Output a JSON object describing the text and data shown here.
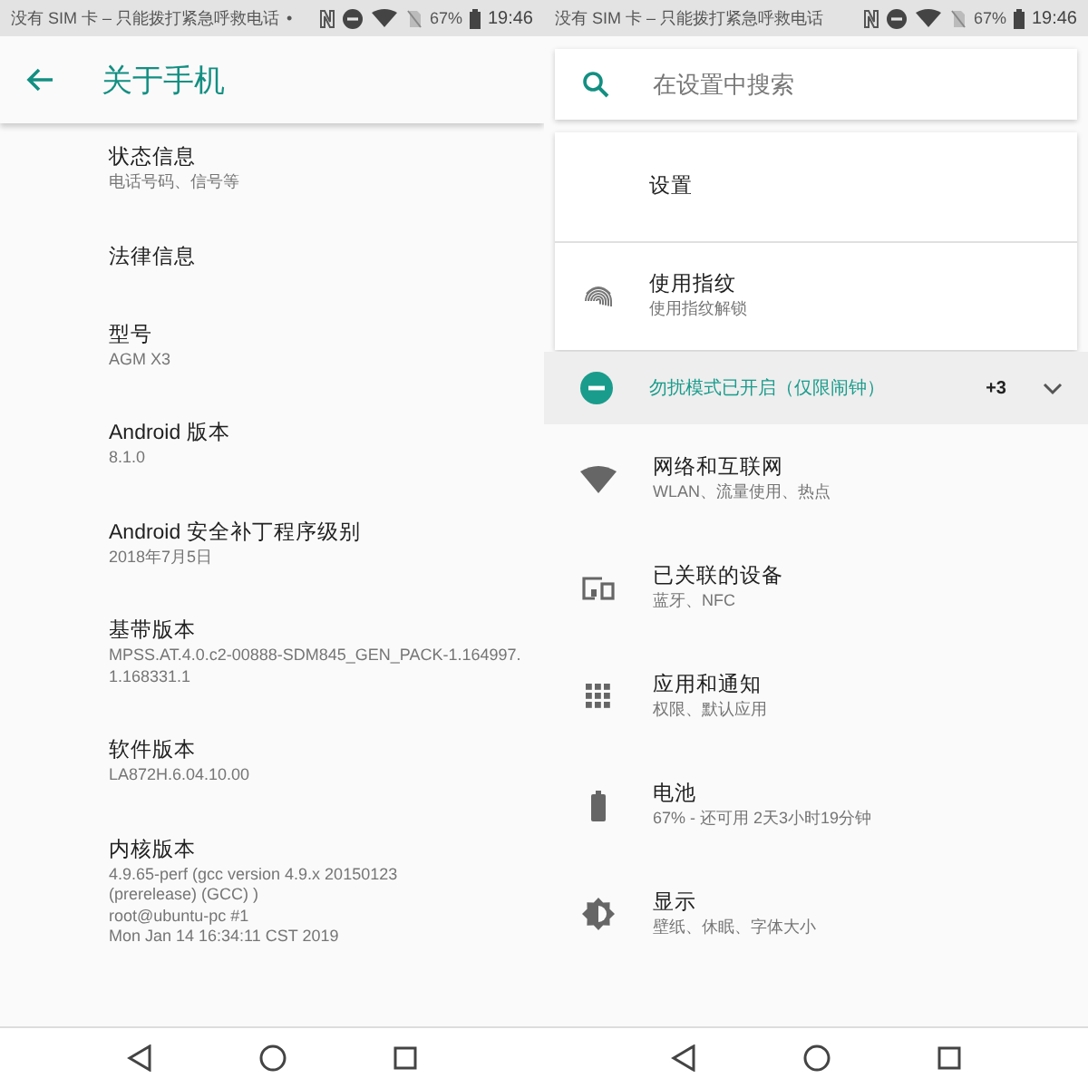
{
  "left": {
    "status_bar": {
      "notice": "没有 SIM 卡 – 只能拨打紧急呼救电话",
      "notice_dot": "•",
      "battery": "67%",
      "time": "19:46"
    },
    "app_bar": {
      "title": "关于手机"
    },
    "items": [
      {
        "title": "状态信息",
        "subtitle": "电话号码、信号等"
      },
      {
        "title": "法律信息"
      },
      {
        "title": "型号",
        "subtitle": "AGM X3"
      },
      {
        "title": "Android 版本",
        "subtitle": "8.1.0"
      },
      {
        "title": "Android 安全补丁程序级别",
        "subtitle": "2018年7月5日"
      },
      {
        "title": "基带版本",
        "subtitle": "MPSS.AT.4.0.c2-00888-SDM845_GEN_PACK-1.164997.1.168331.1"
      },
      {
        "title": "软件版本",
        "subtitle": "LA872H.6.04.10.00"
      },
      {
        "title": "内核版本",
        "subtitle": "4.9.65-perf (gcc version 4.9.x 20150123\n(prerelease) (GCC) )\nroot@ubuntu-pc #1\nMon Jan 14 16:34:11 CST 2019"
      }
    ]
  },
  "right": {
    "status_bar": {
      "notice": "没有 SIM 卡 – 只能拨打紧急呼救电话",
      "battery": "67%",
      "time": "19:46"
    },
    "search": {
      "placeholder": "在设置中搜索"
    },
    "suggestions": [
      {
        "title": "设置"
      },
      {
        "title": "使用指纹",
        "subtitle": "使用指纹解锁"
      }
    ],
    "condition": {
      "text": "勿扰模式已开启（仅限闹钟）",
      "count": "+3",
      "expanded": false
    },
    "categories": [
      {
        "title": "网络和互联网",
        "subtitle": "WLAN、流量使用、热点"
      },
      {
        "title": "已关联的设备",
        "subtitle": "蓝牙、NFC"
      },
      {
        "title": "应用和通知",
        "subtitle": "权限、默认应用"
      },
      {
        "title": "电池",
        "subtitle": "67% - 还可用 2天3小时19分钟"
      },
      {
        "title": "显示",
        "subtitle": "壁纸、休眠、字体大小"
      }
    ]
  }
}
